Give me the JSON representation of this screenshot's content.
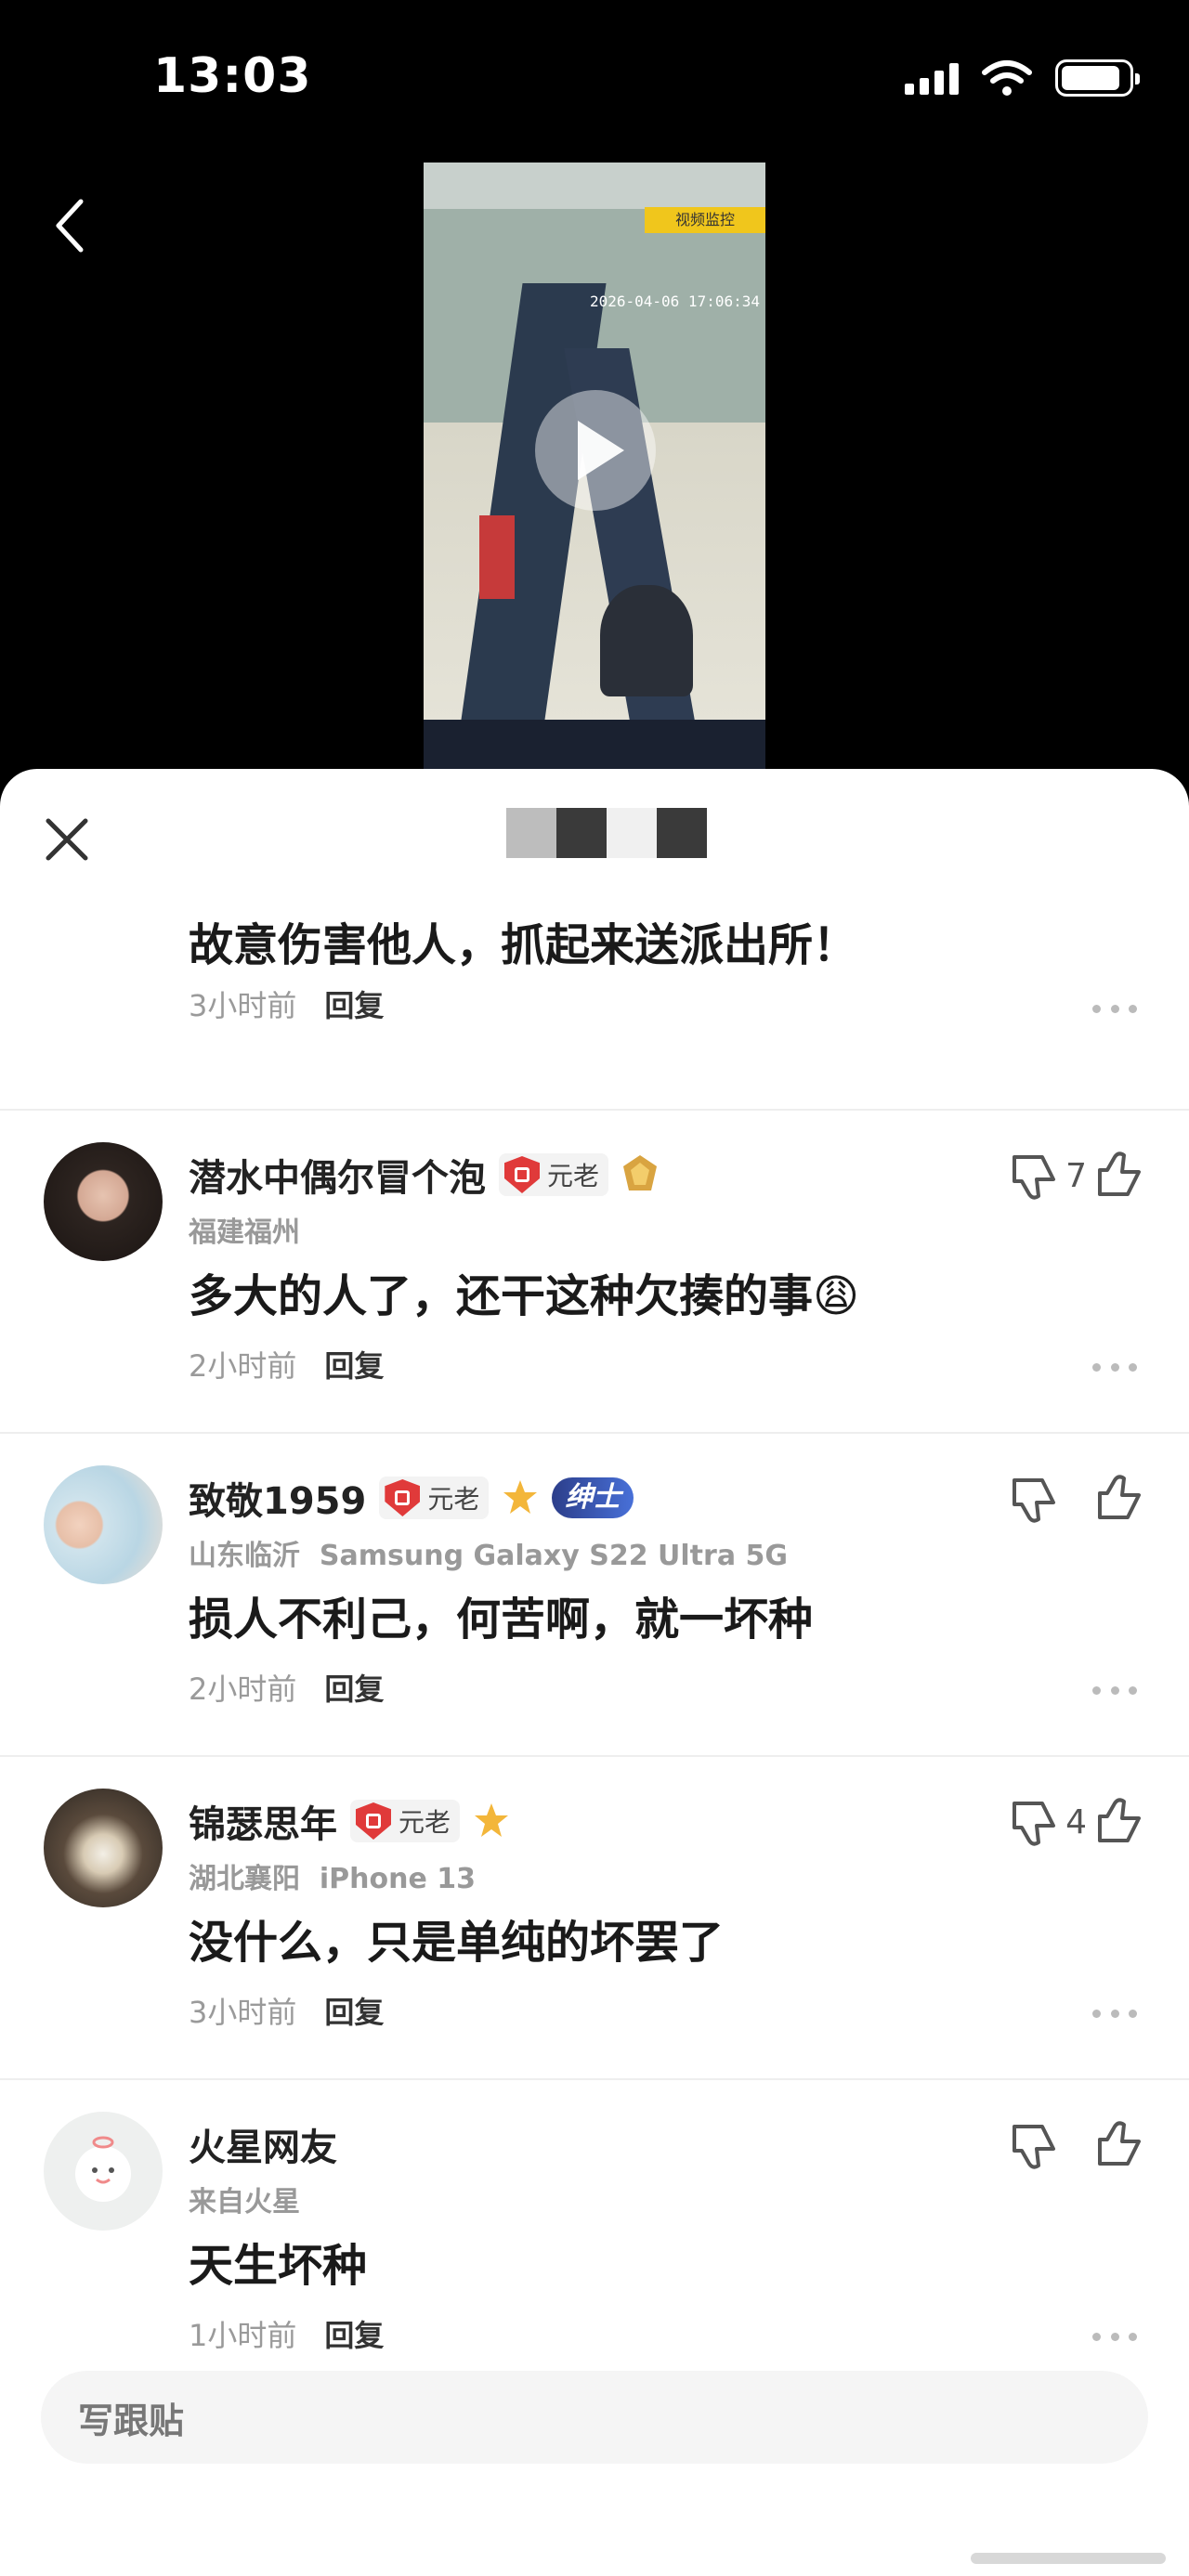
{
  "status_bar": {
    "time": "13:03"
  },
  "video": {
    "overlay_tag": "视频监控",
    "timestamp": "2026-04-06 17:06:34"
  },
  "sheet": {
    "close_icon": "close-icon",
    "comments": [
      {
        "content": "故意伤害他人，抓起来送派出所！",
        "time": "3小时前",
        "reply": "回复"
      },
      {
        "name": "潜水中偶尔冒个泡",
        "badge": "元老",
        "location": "福建福州",
        "content": "多大的人了，还干这种欠揍的事😩",
        "time": "2小时前",
        "reply": "回复",
        "likes": "7"
      },
      {
        "name": "致敬1959",
        "badge": "元老",
        "tag": "绅士",
        "location": "山东临沂",
        "device": "Samsung Galaxy S22 Ultra 5G",
        "content": "损人不利己，何苦啊，就一坏种",
        "time": "2小时前",
        "reply": "回复"
      },
      {
        "name": "锦瑟思年",
        "badge": "元老",
        "location": "湖北襄阳",
        "device": "iPhone 13",
        "content": "没什么，只是单纯的坏罢了",
        "time": "3小时前",
        "reply": "回复",
        "likes": "4"
      },
      {
        "name": "火星网友",
        "location": "来自火星",
        "content": "天生坏种",
        "time": "1小时前",
        "reply": "回复"
      }
    ],
    "compose_placeholder": "写跟贴"
  },
  "colors": {
    "accent_red": "#e03a3a",
    "gentleman_blue": "#3558c0"
  }
}
